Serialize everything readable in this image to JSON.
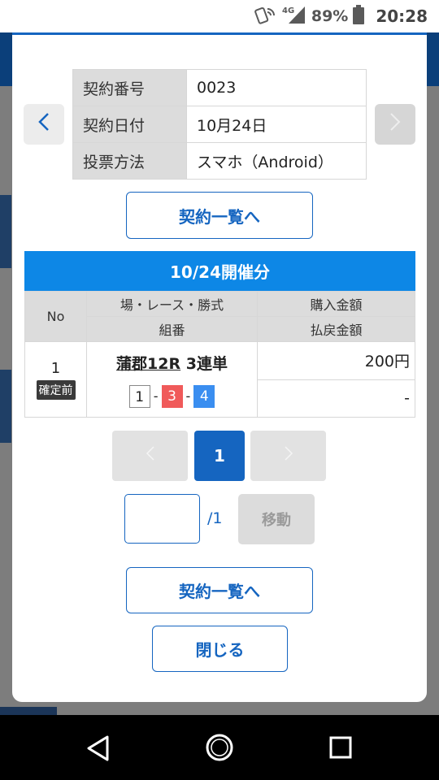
{
  "status_bar": {
    "network": "4G",
    "battery": "89%",
    "time": "20:28"
  },
  "info": {
    "rows": [
      {
        "key": "契約番号",
        "value": "0023"
      },
      {
        "key": "契約日付",
        "value": "10月24日"
      },
      {
        "key": "投票方法",
        "value": "スマホ（Android）"
      }
    ]
  },
  "buttons": {
    "contract_list_top": "契約一覧へ",
    "contract_list_bottom": "契約一覧へ",
    "close": "閉じる",
    "move": "移動"
  },
  "section": {
    "title": "10/24開催分"
  },
  "table": {
    "headers": {
      "no": "No",
      "race": "場・レース・勝式",
      "combo": "組番",
      "purchase": "購入金額",
      "payout": "払戻金額"
    },
    "row": {
      "no": "1",
      "status_badge": "確定前",
      "race_place": "蒲郡12R",
      "bet_type": "3連単",
      "combo": [
        "1",
        "3",
        "4"
      ],
      "separator": "-",
      "purchase": "200円",
      "payout": "-"
    }
  },
  "pagination": {
    "current": "1",
    "total_label": "/1",
    "input_value": ""
  },
  "colors": {
    "accent": "#1565c0",
    "header_bg": "#0d87e6",
    "boat1": "#ffffff",
    "boat3": "#f05a5a",
    "boat4": "#3a8ef0"
  },
  "icons": {
    "prev": "chevron-left-icon",
    "next": "chevron-right-icon"
  }
}
